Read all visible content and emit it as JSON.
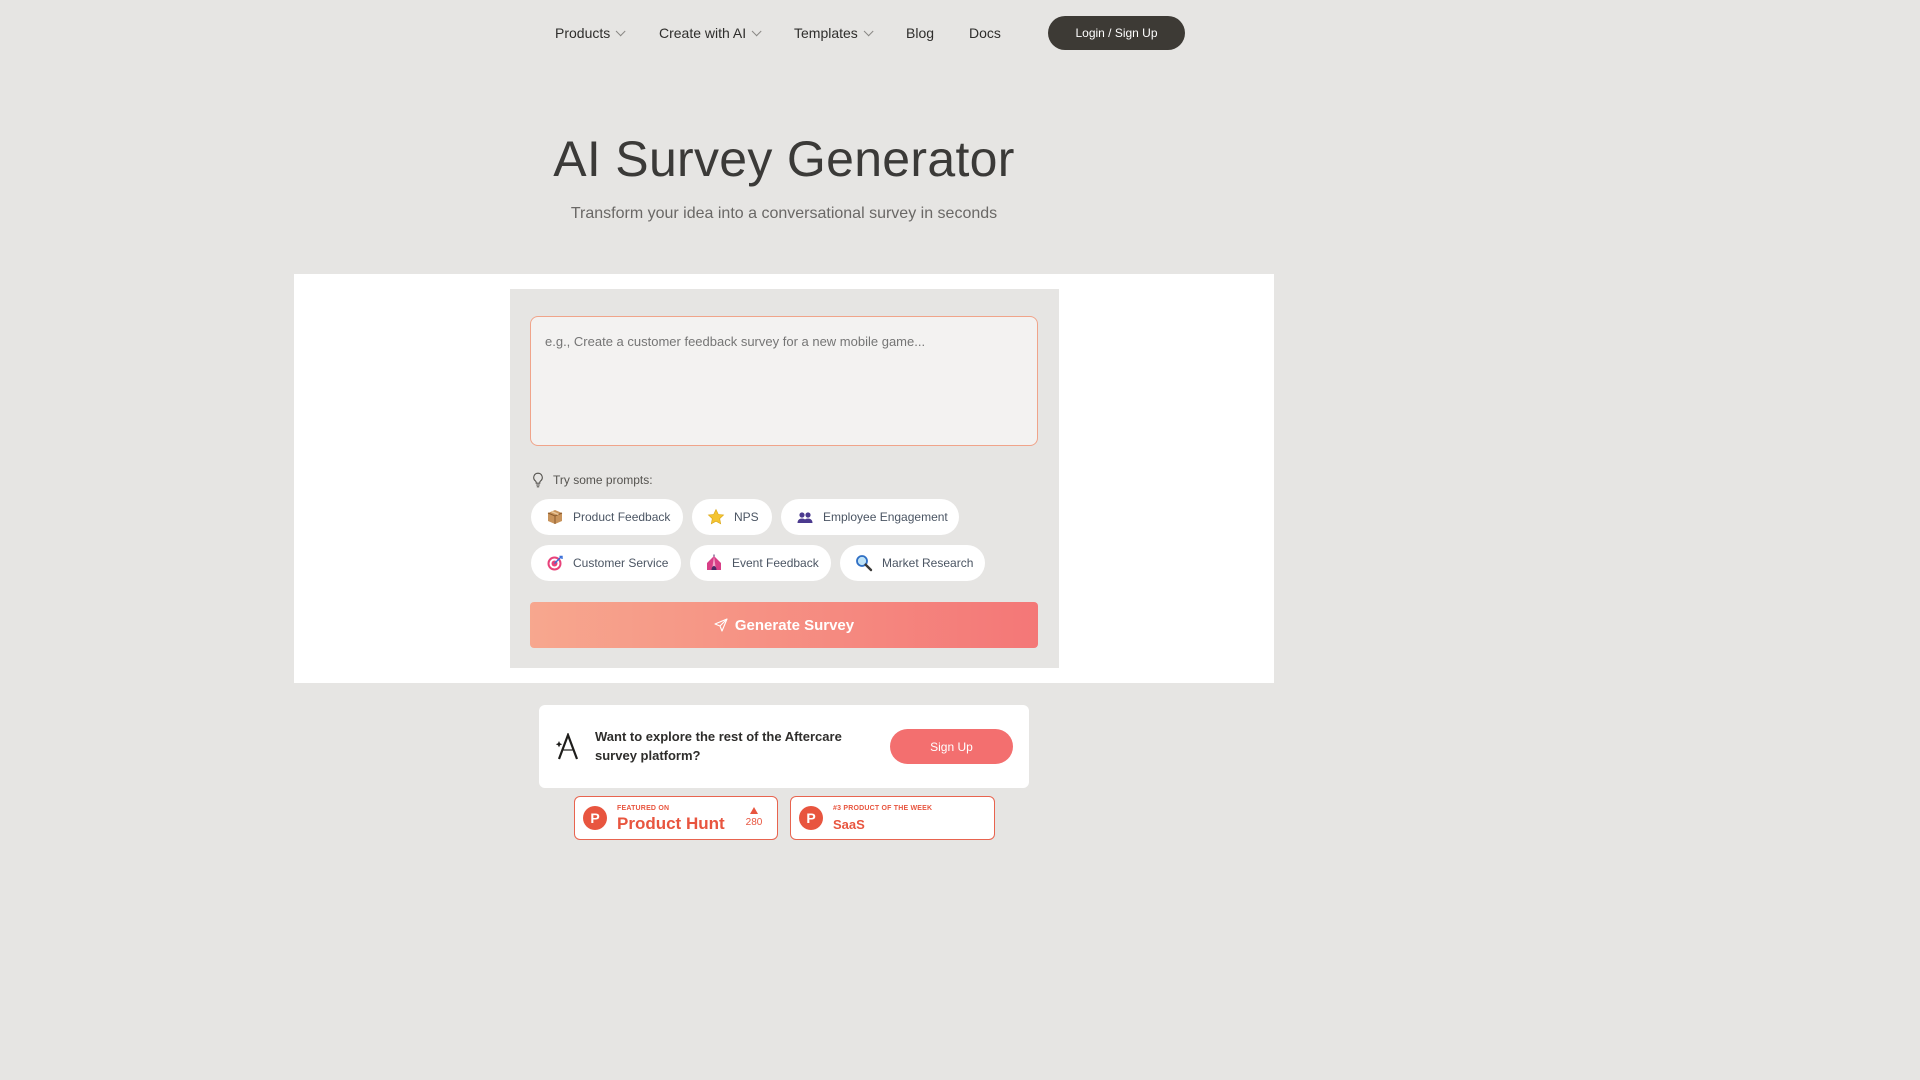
{
  "nav": {
    "items": [
      {
        "label": "Products",
        "dropdown": true
      },
      {
        "label": "Create with AI",
        "dropdown": true
      },
      {
        "label": "Templates",
        "dropdown": true
      },
      {
        "label": "Blog",
        "dropdown": false
      },
      {
        "label": "Docs",
        "dropdown": false
      }
    ],
    "login_label": "Login / Sign Up"
  },
  "hero": {
    "title": "AI Survey Generator",
    "subtitle": "Transform your idea into a conversational survey in seconds"
  },
  "generator": {
    "placeholder": "e.g., Create a customer feedback survey for a new mobile game...",
    "value": "",
    "try_label": "Try some prompts:",
    "chips": [
      {
        "label": "Product Feedback",
        "icon": "package-icon"
      },
      {
        "label": "NPS",
        "icon": "star-icon"
      },
      {
        "label": "Employee Engagement",
        "icon": "people-icon"
      },
      {
        "label": "Customer Service",
        "icon": "target-icon"
      },
      {
        "label": "Event Feedback",
        "icon": "circus-tent-icon"
      },
      {
        "label": "Market Research",
        "icon": "magnifier-icon"
      }
    ],
    "generate_label": "Generate Survey"
  },
  "promo": {
    "text": "Want to explore the rest of the Aftercare survey platform?",
    "button_label": "Sign Up"
  },
  "badges": [
    {
      "small": "FEATURED ON",
      "big": "Product Hunt",
      "votes": "280"
    },
    {
      "small": "#3 PRODUCT OF THE WEEK",
      "big": "SaaS"
    }
  ],
  "colors": {
    "background": "#e6e5e3",
    "accent_start": "#f7a78e",
    "accent_end": "#f47777",
    "product_hunt": "#e8553f",
    "dark_button": "#3d3a35"
  }
}
